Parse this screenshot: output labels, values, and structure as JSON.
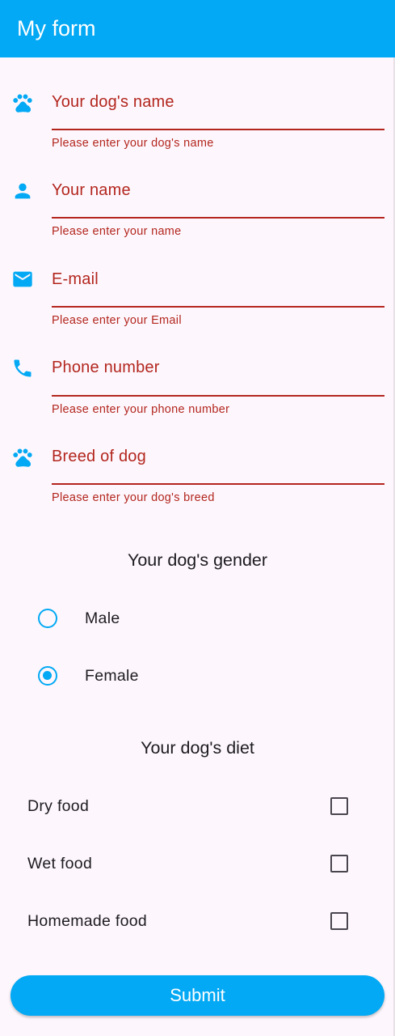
{
  "appbar": {
    "title": "My form",
    "color": "#03a9f4"
  },
  "fields": [
    {
      "label": "Your dog's name",
      "error": "Please enter your dog's name",
      "icon": "paw-icon"
    },
    {
      "label": "Your name",
      "error": "Please enter your name",
      "icon": "person-icon"
    },
    {
      "label": "E-mail",
      "error": "Please enter your Email",
      "icon": "email-icon"
    },
    {
      "label": "Phone number",
      "error": "Please enter your phone number",
      "icon": "phone-icon"
    },
    {
      "label": "Breed of dog",
      "error": "Please enter your dog's breed",
      "icon": "paw-icon"
    }
  ],
  "gender": {
    "title": "Your dog's gender",
    "options": [
      {
        "label": "Male",
        "selected": false
      },
      {
        "label": "Female",
        "selected": true
      }
    ]
  },
  "diet": {
    "title": "Your dog's diet",
    "options": [
      {
        "label": "Dry food",
        "checked": false
      },
      {
        "label": "Wet food",
        "checked": false
      },
      {
        "label": "Homemade food",
        "checked": false
      }
    ]
  },
  "submit_label": "Submit",
  "colors": {
    "accent": "#03a9f4",
    "error": "#b3261e",
    "background": "#fdf7fd"
  }
}
